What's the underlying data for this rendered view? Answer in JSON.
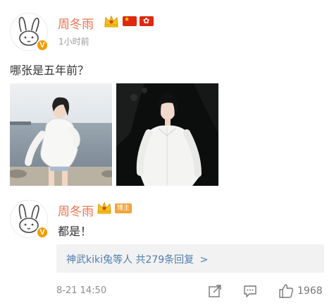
{
  "post": {
    "author": "周冬雨",
    "time": "1小时前",
    "text": "哪张是五年前？"
  },
  "comment": {
    "author": "周冬雨",
    "badge": "博主",
    "text": "都是！",
    "replies_users": "神武kiki兔等人",
    "replies_count": "共279条回复",
    "replies_arrow": ">",
    "timestamp": "8-21 14:50",
    "like_count": "1968"
  },
  "icons": [
    "avatar-bunny",
    "verified-v",
    "crown-icon",
    "china-flag",
    "hong-kong-flag",
    "share-icon",
    "comment-icon",
    "like-icon"
  ],
  "colors": {
    "name": "#eb7350",
    "link": "#507daf",
    "verified": "#f29c00",
    "badge": "#f2a33a"
  }
}
